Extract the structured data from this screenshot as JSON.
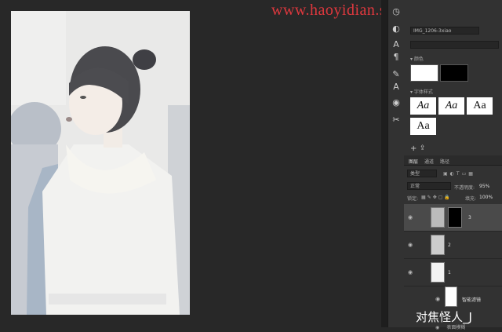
{
  "watermark": "www.haoyidian.shop.com",
  "properties": {
    "layer_name": "IMG_1206-3xiao",
    "color_section": "颜色",
    "fonts_section": "字体样式",
    "font_samples": [
      "Aa",
      "Aa",
      "Aa",
      "Aa"
    ]
  },
  "layers_panel": {
    "tabs": [
      "图层",
      "通道",
      "路径"
    ],
    "filter_kind": "类型",
    "blend_mode": "正常",
    "opacity_label": "不透明度:",
    "opacity_value": "95%",
    "lock_label": "锁定:",
    "fill_label": "填充:",
    "fill_value": "100%",
    "layers": [
      {
        "name": "3"
      },
      {
        "name": "2"
      },
      {
        "name": "1"
      }
    ],
    "smart_filters_label": "智能滤镜",
    "filter_item": "表面模糊"
  },
  "bottom_watermark": "对焦怪人_J",
  "colors": {
    "app_bg": "#282828",
    "panel_bg": "#323232",
    "watermark": "#e0383e",
    "selected_row": "#4a4a4a"
  }
}
